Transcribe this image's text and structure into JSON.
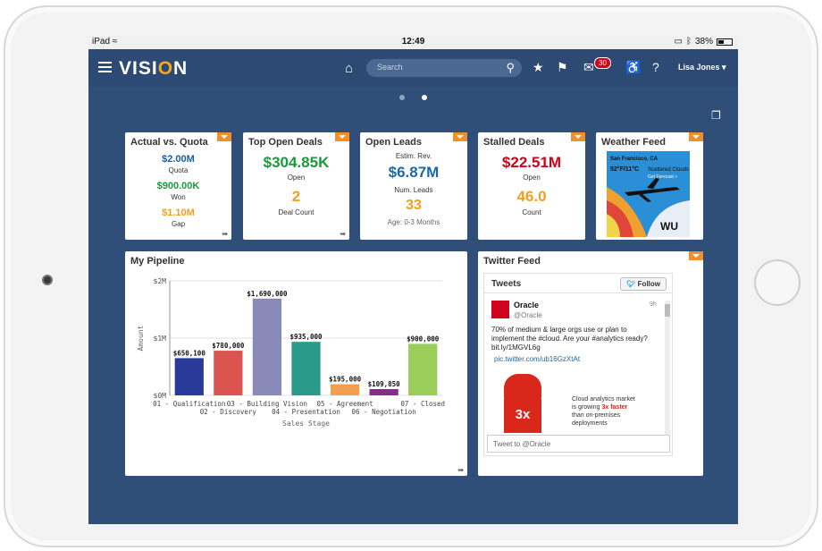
{
  "status_bar": {
    "device": "iPad",
    "time": "12:49",
    "battery": "38%"
  },
  "app": {
    "logo": "VISI",
    "logo_o": "O",
    "logo_n": "N",
    "search_placeholder": "Search",
    "notification_count": "30",
    "user_name": "Lisa Jones ▾"
  },
  "cards": {
    "actual_vs_quota": {
      "title": "Actual vs. Quota",
      "quota_value": "$2.00M",
      "quota_label": "Quota",
      "won_value": "$900.00K",
      "won_label": "Won",
      "gap_value": "$1.10M",
      "gap_label": "Gap"
    },
    "top_open_deals": {
      "title": "Top Open Deals",
      "open_value": "$304.85K",
      "open_label": "Open",
      "count_value": "2",
      "count_label": "Deal Count"
    },
    "open_leads": {
      "title": "Open Leads",
      "rev_label": "Estim. Rev.",
      "rev_value": "$6.87M",
      "num_label": "Num. Leads",
      "num_value": "33",
      "age_label": "Age: 0-3 Months"
    },
    "stalled_deals": {
      "title": "Stalled Deals",
      "open_value": "$22.51M",
      "open_label": "Open",
      "count_value": "46.0",
      "count_label": "Count"
    },
    "weather_feed": {
      "title": "Weather Feed",
      "city": "San Francisco, CA",
      "temp": "52°F/11°C",
      "condition": "Scattered Clouds",
      "link": "Get Forecast »",
      "brand": "WU"
    }
  },
  "pipeline": {
    "title": "My Pipeline"
  },
  "chart_data": {
    "type": "bar",
    "xlabel": "Sales Stage",
    "ylabel": "Amount",
    "ylim": [
      0,
      2000000
    ],
    "yticks": [
      "$0M",
      "$1M",
      "$2M"
    ],
    "categories": [
      "01 - Qualification",
      "02 - Discovery",
      "03 - Building Vision",
      "04 - Presentation",
      "05 - Agreement",
      "06 - Negotiation",
      "07 - Closed"
    ],
    "values": [
      650100,
      780000,
      1690000,
      935000,
      195000,
      109850,
      900000
    ],
    "value_labels": [
      "$650,100",
      "$780,000",
      "$1,690,000",
      "$935,000",
      "$195,000",
      "$109,850",
      "$900,000"
    ],
    "colors": [
      "#2a3a9a",
      "#d9534f",
      "#8a8ab8",
      "#2a9a8a",
      "#f0a050",
      "#8a2a8a",
      "#9acd5a"
    ]
  },
  "twitter": {
    "title": "Twitter Feed",
    "tweets_label": "Tweets",
    "follow_label": "Follow",
    "account_name": "Oracle",
    "account_handle": "@Oracle",
    "time": "9h",
    "tweet_text": "70% of medium & large orgs use or plan to implement the #cloud. Are your #analytics ready? bit.ly/1MGVL6g",
    "tweet_link": "pic.twitter.com/ub16GzXtAt",
    "image_badge": "3x",
    "image_text_1": "Cloud analytics market",
    "image_text_2": "is growing",
    "image_text_3": "3x faster",
    "image_text_4": "than on-premises",
    "image_text_5": "deployments",
    "compose_placeholder": "Tweet to @Oracle"
  }
}
